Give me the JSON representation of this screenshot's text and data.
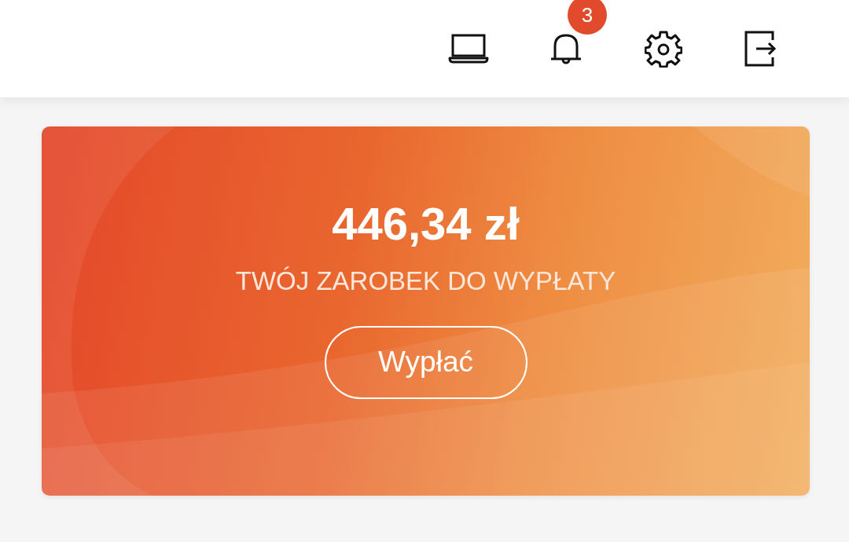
{
  "header": {
    "icons": [
      {
        "kind": "laptop"
      },
      {
        "kind": "bell",
        "badge": "3"
      },
      {
        "kind": "settings"
      },
      {
        "kind": "logout"
      }
    ]
  },
  "balance_card": {
    "amount": "446,34 zł",
    "label": "TWÓJ ZAROBEK DO WYPŁATY",
    "button": "Wypłać"
  }
}
